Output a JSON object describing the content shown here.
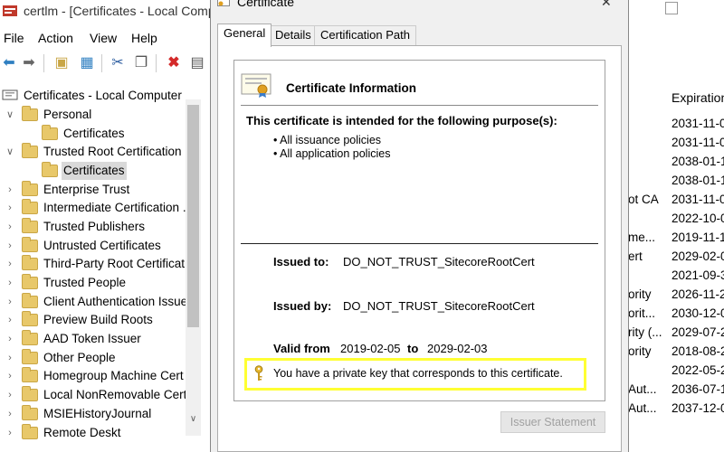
{
  "window": {
    "title": "certlm - [Certificates - Local Comp"
  },
  "menu": [
    "File",
    "Action",
    "View",
    "Help"
  ],
  "tree": {
    "root_label": "Certificates - Local Computer",
    "items": [
      {
        "label": "Personal"
      },
      {
        "label": "Certificates"
      },
      {
        "label": "Trusted Root Certification ."
      },
      {
        "label": "Certificates"
      },
      {
        "label": "Enterprise Trust"
      },
      {
        "label": "Intermediate Certification ."
      },
      {
        "label": "Trusted Publishers"
      },
      {
        "label": "Untrusted Certificates"
      },
      {
        "label": "Third-Party Root Certificat"
      },
      {
        "label": "Trusted People"
      },
      {
        "label": "Client Authentication Issue"
      },
      {
        "label": "Preview Build Roots"
      },
      {
        "label": "AAD Token Issuer"
      },
      {
        "label": "Other People"
      },
      {
        "label": "Homegroup Machine Cert"
      },
      {
        "label": "Local NonRemovable Certi"
      },
      {
        "label": "MSIEHistoryJournal"
      },
      {
        "label": "Remote Deskt"
      }
    ]
  },
  "list": {
    "expiration_header": "Expiration",
    "rows": [
      {
        "left": "",
        "exp": "2031-11-0"
      },
      {
        "left": "",
        "exp": "2031-11-0"
      },
      {
        "left": "",
        "exp": "2038-01-1"
      },
      {
        "left": "",
        "exp": "2038-01-1"
      },
      {
        "left": "ot CA",
        "exp": "2031-11-0"
      },
      {
        "left": "",
        "exp": "2022-10-0"
      },
      {
        "left": "me...",
        "exp": "2019-11-1"
      },
      {
        "left": "ert",
        "exp": "2029-02-0"
      },
      {
        "left": "",
        "exp": "2021-09-3"
      },
      {
        "left": "ority",
        "exp": "2026-11-2"
      },
      {
        "left": "orit...",
        "exp": "2030-12-0"
      },
      {
        "left": "rity (...",
        "exp": "2029-07-2"
      },
      {
        "left": "ority",
        "exp": "2018-08-2"
      },
      {
        "left": "",
        "exp": "2022-05-2"
      },
      {
        "left": "Aut...",
        "exp": "2036-07-1"
      },
      {
        "left": "Aut...",
        "exp": "2037-12-0"
      }
    ]
  },
  "dialog": {
    "title": "Certificate",
    "tabs": [
      "General",
      "Details",
      "Certification Path"
    ],
    "info_title": "Certificate Information",
    "purpose_heading": "This certificate is intended for the following purpose(s):",
    "purposes": [
      "• All issuance policies",
      "• All application policies"
    ],
    "issued_to_label": "Issued to:",
    "issued_to_value": "DO_NOT_TRUST_SitecoreRootCert",
    "issued_by_label": "Issued by:",
    "issued_by_value": "DO_NOT_TRUST_SitecoreRootCert",
    "valid_from_label": "Valid from",
    "valid_from_value": "2019-02-05",
    "valid_to_label": "to",
    "valid_to_value": "2029-02-03",
    "private_key_text": "You have a private key that corresponds to this certificate.",
    "issuer_statement_button": "Issuer Statement"
  },
  "colors": {
    "highlight": "#ffff33",
    "folder": "#e8c86a"
  }
}
